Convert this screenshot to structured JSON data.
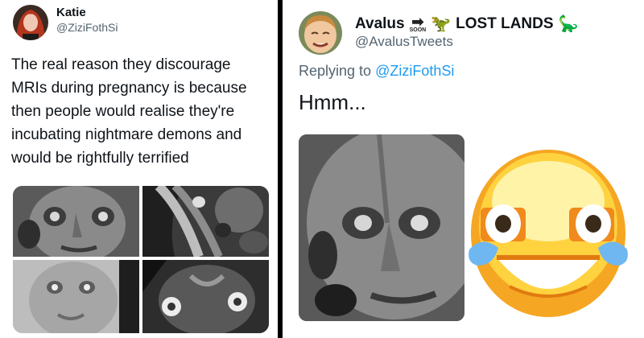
{
  "left_tweet": {
    "author_name": "Katie",
    "author_handle": "@ZiziFothSi",
    "text": "The real reason they discourage MRIs during pregnancy is because then people would realise they're incubating nightmare demons and would be rightfully terrified",
    "media": [
      {
        "icon": "mri-face-scan"
      },
      {
        "icon": "mri-spine-scan"
      },
      {
        "icon": "mri-face-scan-light"
      },
      {
        "icon": "mri-face-scan-dark"
      }
    ]
  },
  "right_tweet": {
    "author_name": "Avalus",
    "arrow_badge": "SOON",
    "name_suffix": "LOST LANDS",
    "author_handle": "@AvalusTweets",
    "reply_prefix": "Replying to",
    "reply_to": "@ZiziFothSi",
    "text": "Hmm...",
    "media": [
      {
        "icon": "mri-face-scan-closeup"
      },
      {
        "icon": "laughing-crying-emoji"
      }
    ]
  },
  "colors": {
    "text_primary": "#0f1419",
    "text_secondary": "#536471",
    "link_blue": "#1d9bf0",
    "divider": "#000000"
  }
}
